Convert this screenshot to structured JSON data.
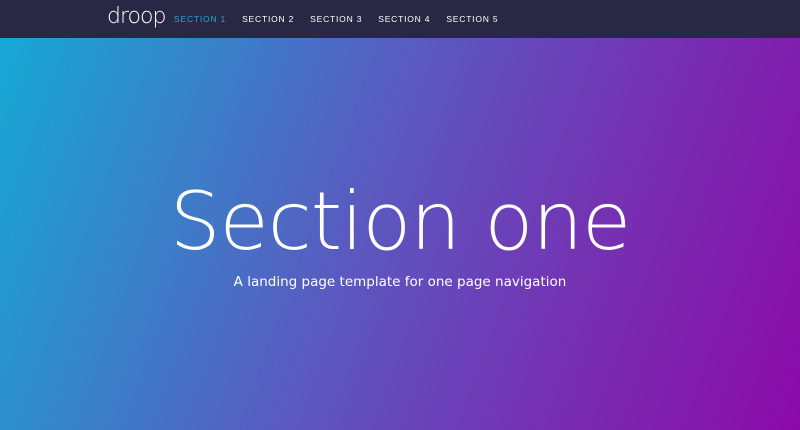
{
  "navbar": {
    "logo": "droop",
    "links": [
      {
        "label": "SECTION 1",
        "active": true
      },
      {
        "label": "SECTION 2",
        "active": false
      },
      {
        "label": "SECTION 3",
        "active": false
      },
      {
        "label": "SECTION 4",
        "active": false
      },
      {
        "label": "SECTION 5",
        "active": false
      }
    ]
  },
  "hero": {
    "title": "Section one",
    "subtitle": "A landing page template for one page navigation"
  },
  "colors": {
    "navbar_bg": "#282844",
    "active_link": "#2aa6d6",
    "gradient_start": "#16a9d4",
    "gradient_end": "#8c0aa8",
    "text": "#ffffff"
  }
}
